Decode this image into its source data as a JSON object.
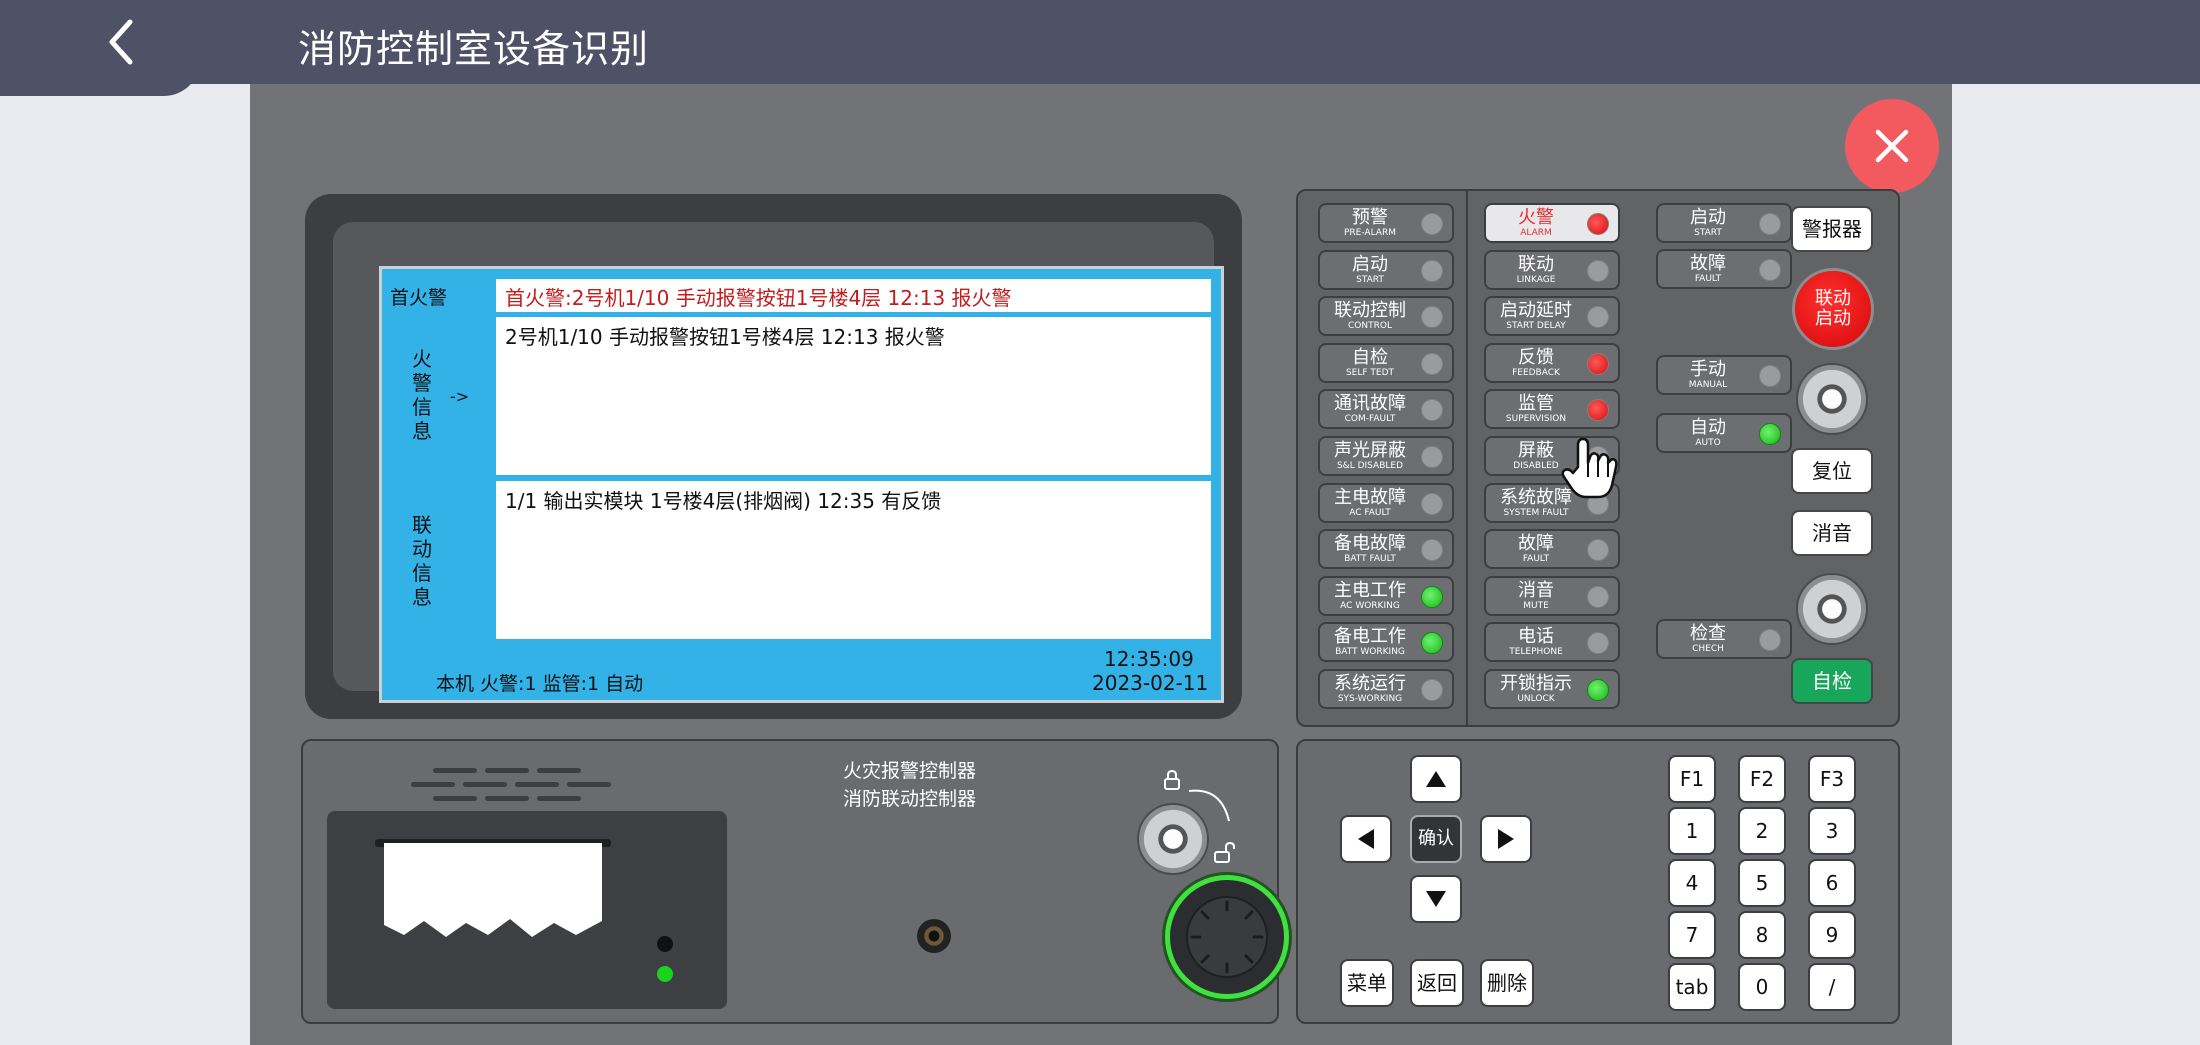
{
  "header": {
    "title": "消防控制室设备识别"
  },
  "screen": {
    "first_alarm_label": "首火警",
    "first_alarm_text": "首火警:2号机1/10 手动报警按钮1号楼4层 12:13 报火警",
    "alarm_info_label": [
      "火",
      "警",
      "信",
      "息"
    ],
    "alarm_arrow": "->",
    "alarm_info_text": "2号机1/10 手动报警按钮1号楼4层 12:13 报火警",
    "linkage_info_label": [
      "联",
      "动",
      "信",
      "息"
    ],
    "linkage_info_text": "1/1 输出实模块 1号楼4层(排烟阀) 12:35 有反馈",
    "status_text": "本机 火警:1 监管:1 自动",
    "time": "12:35:09",
    "date": "2023-02-11"
  },
  "indicators": {
    "col1": [
      {
        "zh": "预警",
        "en": "PRE-ALARM",
        "led": "off"
      },
      {
        "zh": "启动",
        "en": "START",
        "led": "off"
      },
      {
        "zh": "联动控制",
        "en": "CONTROL",
        "led": "off"
      },
      {
        "zh": "自检",
        "en": "SELF TEDT",
        "led": "off"
      },
      {
        "zh": "通讯故障",
        "en": "COM-FAULT",
        "led": "off"
      },
      {
        "zh": "声光屏蔽",
        "en": "S&L DISABLED",
        "led": "off"
      },
      {
        "zh": "主电故障",
        "en": "AC FAULT",
        "led": "off"
      },
      {
        "zh": "备电故障",
        "en": "BATT FAULT",
        "led": "off"
      },
      {
        "zh": "主电工作",
        "en": "AC WORKING",
        "led": "green"
      },
      {
        "zh": "备电工作",
        "en": "BATT WORKING",
        "led": "green"
      },
      {
        "zh": "系统运行",
        "en": "SYS-WORKING",
        "led": "off"
      }
    ],
    "col2": [
      {
        "zh": "火警",
        "en": "ALARM",
        "led": "red"
      },
      {
        "zh": "联动",
        "en": "LINKAGE",
        "led": "off"
      },
      {
        "zh": "启动延时",
        "en": "START DELAY",
        "led": "off"
      },
      {
        "zh": "反馈",
        "en": "FEEDBACK",
        "led": "red"
      },
      {
        "zh": "监管",
        "en": "SUPERVISION",
        "led": "red"
      },
      {
        "zh": "屏蔽",
        "en": "DISABLED",
        "led": "off"
      },
      {
        "zh": "系统故障",
        "en": "SYSTEM FAULT",
        "led": "off"
      },
      {
        "zh": "故障",
        "en": "FAULT",
        "led": "off"
      },
      {
        "zh": "消音",
        "en": "MUTE",
        "led": "off"
      },
      {
        "zh": "电话",
        "en": "TELEPHONE",
        "led": "off"
      },
      {
        "zh": "开锁指示",
        "en": "UNLOCK",
        "led": "green"
      }
    ],
    "col3": [
      {
        "zh": "启动",
        "en": "START",
        "led": "off"
      },
      {
        "zh": "故障",
        "en": "FAULT",
        "led": "off"
      },
      {
        "zh": "手动",
        "en": "MANUAL",
        "led": "off"
      },
      {
        "zh": "自动",
        "en": "AUTO",
        "led": "green"
      },
      {
        "zh": "检查",
        "en": "CHECH",
        "led": "off"
      }
    ]
  },
  "side_buttons": {
    "siren": "警报器",
    "linkage_start": "联动启动",
    "reset": "复位",
    "mute": "消音",
    "self_check": "自检"
  },
  "controller": {
    "title_line1": "火灾报警控制器",
    "title_line2": "消防联动控制器"
  },
  "keypad": {
    "confirm": "确认",
    "menu": "菜单",
    "back": "返回",
    "delete": "删除",
    "fkeys": [
      "F1",
      "F2",
      "F3"
    ],
    "numkeys": [
      "1",
      "2",
      "3",
      "4",
      "5",
      "6",
      "7",
      "8",
      "9",
      "tab",
      "0",
      "/"
    ]
  }
}
